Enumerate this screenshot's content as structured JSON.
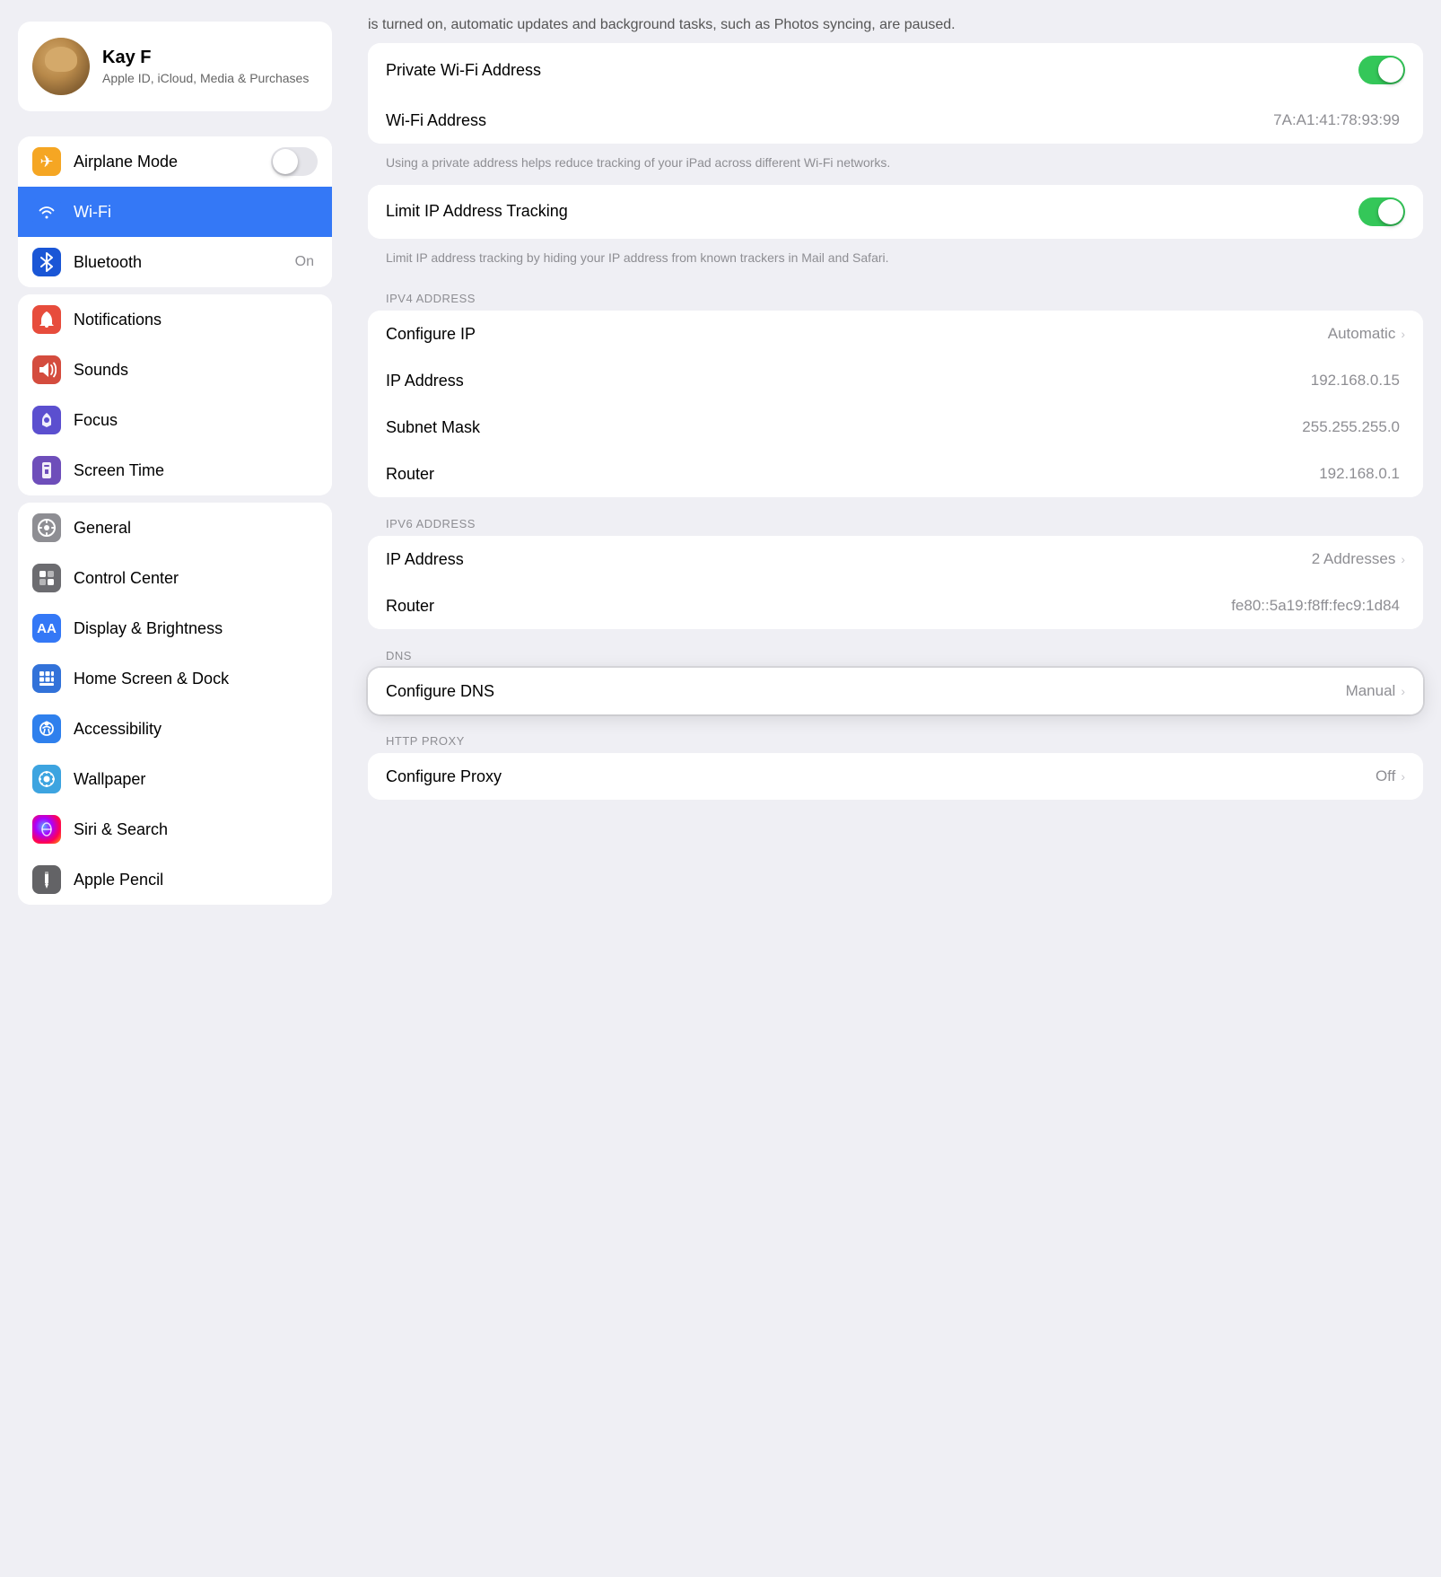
{
  "profile": {
    "name": "Kay F",
    "subtitle": "Apple ID, iCloud, Media & Purchases"
  },
  "sidebar": {
    "groups": [
      {
        "id": "connectivity",
        "items": [
          {
            "id": "airplane-mode",
            "label": "Airplane Mode",
            "icon": "✈",
            "iconClass": "icon-orange",
            "value": "",
            "hasToggle": true,
            "toggleOn": false,
            "selected": false
          },
          {
            "id": "wifi",
            "label": "Wi-Fi",
            "icon": "wifi",
            "iconClass": "icon-blue",
            "value": "",
            "selected": true
          },
          {
            "id": "bluetooth",
            "label": "Bluetooth",
            "icon": "bluetooth",
            "iconClass": "icon-blue-dark",
            "value": "On",
            "selected": false
          }
        ]
      },
      {
        "id": "alerts",
        "items": [
          {
            "id": "notifications",
            "label": "Notifications",
            "icon": "bell",
            "iconClass": "icon-red",
            "value": "",
            "selected": false
          },
          {
            "id": "sounds",
            "label": "Sounds",
            "icon": "sound",
            "iconClass": "icon-red-med",
            "value": "",
            "selected": false
          },
          {
            "id": "focus",
            "label": "Focus",
            "icon": "moon",
            "iconClass": "icon-purple-dark",
            "value": "",
            "selected": false
          },
          {
            "id": "screen-time",
            "label": "Screen Time",
            "icon": "hourglass",
            "iconClass": "icon-purple",
            "value": "",
            "selected": false
          }
        ]
      },
      {
        "id": "system",
        "items": [
          {
            "id": "general",
            "label": "General",
            "icon": "gear",
            "iconClass": "icon-gray",
            "value": "",
            "selected": false
          },
          {
            "id": "control-center",
            "label": "Control Center",
            "icon": "toggle",
            "iconClass": "icon-gray-med",
            "value": "",
            "selected": false
          },
          {
            "id": "display-brightness",
            "label": "Display & Brightness",
            "icon": "AA",
            "iconClass": "icon-blue-aa",
            "value": "",
            "selected": false
          },
          {
            "id": "home-screen",
            "label": "Home Screen & Dock",
            "icon": "grid",
            "iconClass": "icon-blue-home",
            "value": "",
            "selected": false
          },
          {
            "id": "accessibility",
            "label": "Accessibility",
            "icon": "person",
            "iconClass": "icon-blue-access",
            "value": "",
            "selected": false
          },
          {
            "id": "wallpaper",
            "label": "Wallpaper",
            "icon": "flower",
            "iconClass": "icon-teal",
            "value": "",
            "selected": false
          },
          {
            "id": "siri-search",
            "label": "Siri & Search",
            "icon": "siri",
            "iconClass": "icon-green-dark",
            "value": "",
            "selected": false
          },
          {
            "id": "apple-pencil",
            "label": "Apple Pencil",
            "icon": "pencil",
            "iconClass": "icon-darkgray",
            "value": "",
            "selected": false
          }
        ]
      }
    ]
  },
  "main": {
    "intro_text": "is turned on, automatic updates and background tasks, such as Photos syncing, are paused.",
    "sections": [
      {
        "id": "privacy",
        "items": [
          {
            "id": "private-wifi-address",
            "label": "Private Wi-Fi Address",
            "value": "",
            "hasToggle": true,
            "toggleOn": true
          },
          {
            "id": "wifi-address",
            "label": "Wi-Fi Address",
            "value": "7A:A1:41:78:93:99",
            "hasToggle": false
          }
        ],
        "desc": "Using a private address helps reduce tracking of your iPad across different Wi-Fi networks."
      },
      {
        "id": "limit-ip",
        "items": [
          {
            "id": "limit-ip-tracking",
            "label": "Limit IP Address Tracking",
            "value": "",
            "hasToggle": true,
            "toggleOn": true
          }
        ],
        "desc": "Limit IP address tracking by hiding your IP address from known trackers in Mail and Safari."
      },
      {
        "id": "ipv4",
        "header": "IPV4 ADDRESS",
        "items": [
          {
            "id": "configure-ip",
            "label": "Configure IP",
            "value": "Automatic",
            "hasChevron": true
          },
          {
            "id": "ip-address-v4",
            "label": "IP Address",
            "value": "192.168.0.15",
            "hasChevron": false
          },
          {
            "id": "subnet-mask",
            "label": "Subnet Mask",
            "value": "255.255.255.0",
            "hasChevron": false
          },
          {
            "id": "router-v4",
            "label": "Router",
            "value": "192.168.0.1",
            "hasChevron": false
          }
        ]
      },
      {
        "id": "ipv6",
        "header": "IPV6 ADDRESS",
        "items": [
          {
            "id": "ip-address-v6",
            "label": "IP Address",
            "value": "2 Addresses",
            "hasChevron": true
          },
          {
            "id": "router-v6",
            "label": "Router",
            "value": "fe80::5a19:f8ff:fec9:1d84",
            "hasChevron": false
          }
        ]
      },
      {
        "id": "dns",
        "header": "DNS",
        "highlighted": true,
        "items": [
          {
            "id": "configure-dns",
            "label": "Configure DNS",
            "value": "Manual",
            "hasChevron": true
          }
        ]
      },
      {
        "id": "http-proxy",
        "header": "HTTP PROXY",
        "items": [
          {
            "id": "configure-proxy",
            "label": "Configure Proxy",
            "value": "Off",
            "hasChevron": true
          }
        ]
      }
    ]
  },
  "icons": {
    "wifi_unicode": "📶",
    "bluetooth_unicode": "🔵",
    "chevron": "›",
    "toggle_icon": "⚙"
  }
}
